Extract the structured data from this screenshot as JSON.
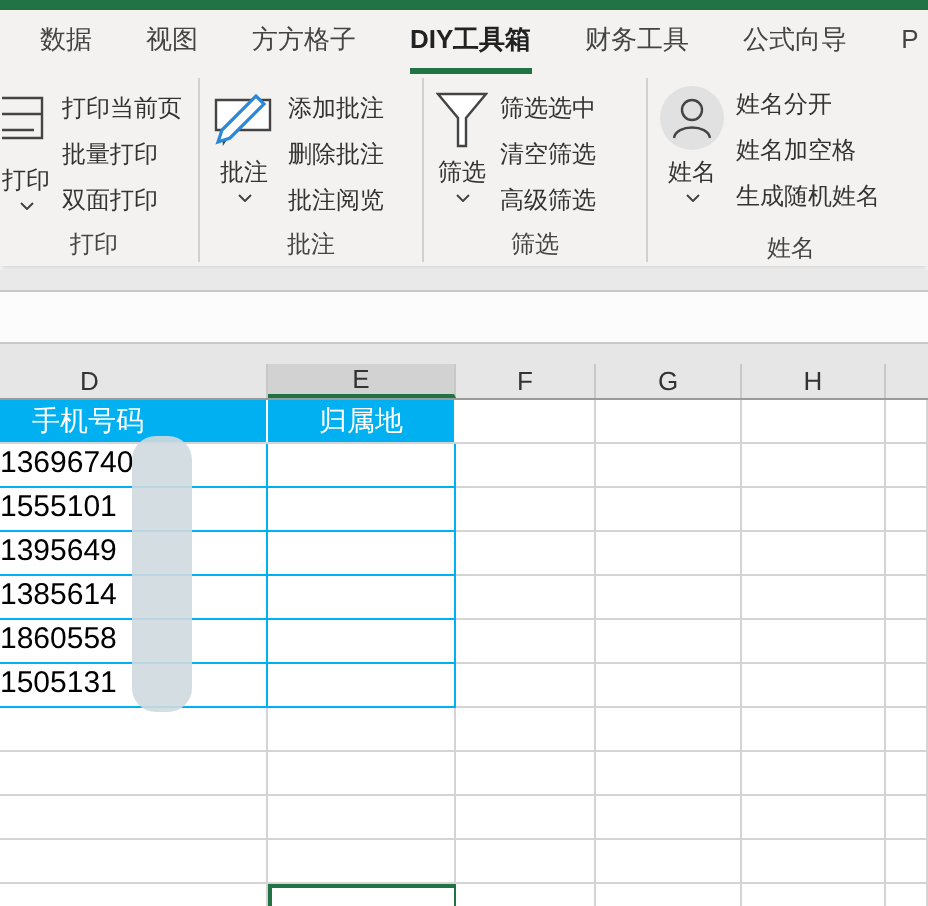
{
  "tabs": [
    {
      "label": "数据",
      "selected": false
    },
    {
      "label": "视图",
      "selected": false
    },
    {
      "label": "方方格子",
      "selected": false
    },
    {
      "label": "DIY工具箱",
      "selected": true
    },
    {
      "label": "财务工具",
      "selected": false
    },
    {
      "label": "公式向导",
      "selected": false
    },
    {
      "label": "P",
      "selected": false
    }
  ],
  "ribbon": {
    "groups": [
      {
        "kind": "printer",
        "label": "打印",
        "big_button": "打印",
        "items": [
          "打印当前页",
          "批量打印",
          "双面打印"
        ]
      },
      {
        "kind": "comment",
        "label": "批注",
        "big_button": "批注",
        "items": [
          "添加批注",
          "删除批注",
          "批注阅览"
        ]
      },
      {
        "kind": "filter",
        "label": "筛选",
        "big_button": "筛选",
        "items": [
          "筛选选中",
          "清空筛选",
          "高级筛选"
        ]
      },
      {
        "kind": "person",
        "label": "姓名",
        "big_button": "姓名",
        "items": [
          "姓名分开",
          "姓名加空格",
          "生成随机姓名"
        ]
      }
    ]
  },
  "sheet": {
    "columns": [
      {
        "label": "D",
        "selected": false
      },
      {
        "label": "E",
        "selected": true
      },
      {
        "label": "F",
        "selected": false
      },
      {
        "label": "G",
        "selected": false
      },
      {
        "label": "H",
        "selected": false
      }
    ],
    "header_row": [
      "手机号码",
      "归属地"
    ],
    "rows": [
      {
        "phone": "13696740"
      },
      {
        "phone": "1555101"
      },
      {
        "phone": "1395649"
      },
      {
        "phone": "1385614"
      },
      {
        "phone": "1860558"
      },
      {
        "phone": "1505131"
      }
    ]
  }
}
